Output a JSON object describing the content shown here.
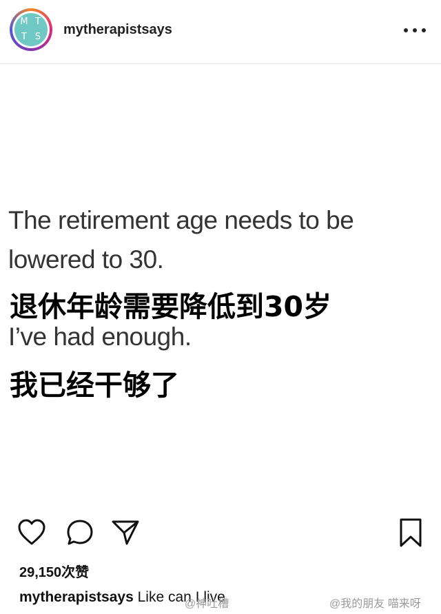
{
  "header": {
    "username": "mytherapistsays",
    "avatar_letters": [
      "M",
      "T",
      "T",
      "S"
    ]
  },
  "post": {
    "line1": "The retirement age needs to be",
    "line2": "lowered to 30.",
    "line3_zh": "退休年龄需要降低到30岁",
    "line4": "I’ve had enough.",
    "line5_zh": "我已经干够了"
  },
  "actions": {
    "like_icon": "heart-icon",
    "comment_icon": "comment-icon",
    "share_icon": "send-icon",
    "save_icon": "bookmark-icon"
  },
  "likes": "29,150次赞",
  "caption": {
    "username": "mytherapistsays",
    "text": "Like can I live"
  },
  "watermarks": {
    "left": "@神吐槽",
    "right": "@我的朋友 喵来呀"
  }
}
